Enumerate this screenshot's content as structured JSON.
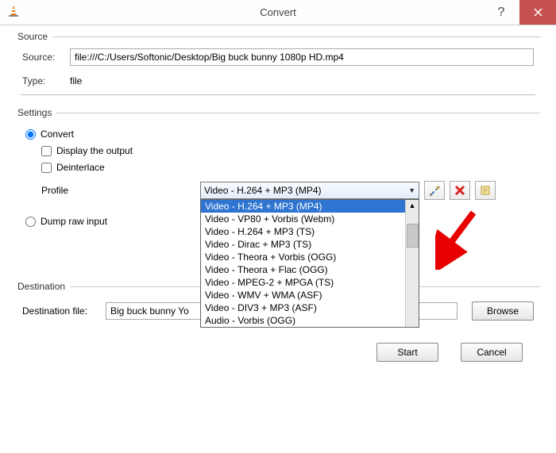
{
  "window": {
    "title": "Convert"
  },
  "source": {
    "legend": "Source",
    "sourceLabel": "Source:",
    "sourceValue": "file:///C:/Users/Softonic/Desktop/Big buck bunny 1080p HD.mp4",
    "typeLabel": "Type:",
    "typeValue": "file"
  },
  "settings": {
    "legend": "Settings",
    "convert": "Convert",
    "display": "Display the output",
    "deinterlace": "Deinterlace",
    "profileLabel": "Profile",
    "profileSelected": "Video - H.264 + MP3 (MP4)",
    "dump": "Dump raw input",
    "options": [
      "Video - H.264 + MP3 (MP4)",
      "Video - VP80 + Vorbis (Webm)",
      "Video - H.264 + MP3 (TS)",
      "Video - Dirac + MP3 (TS)",
      "Video - Theora + Vorbis (OGG)",
      "Video - Theora + Flac (OGG)",
      "Video - MPEG-2 + MPGA (TS)",
      "Video - WMV + WMA (ASF)",
      "Video - DIV3 + MP3 (ASF)",
      "Audio - Vorbis (OGG)"
    ]
  },
  "destination": {
    "legend": "Destination",
    "label": "Destination file:",
    "value": "Big buck bunny Yo",
    "browse": "Browse"
  },
  "buttons": {
    "start": "Start",
    "cancel": "Cancel"
  }
}
